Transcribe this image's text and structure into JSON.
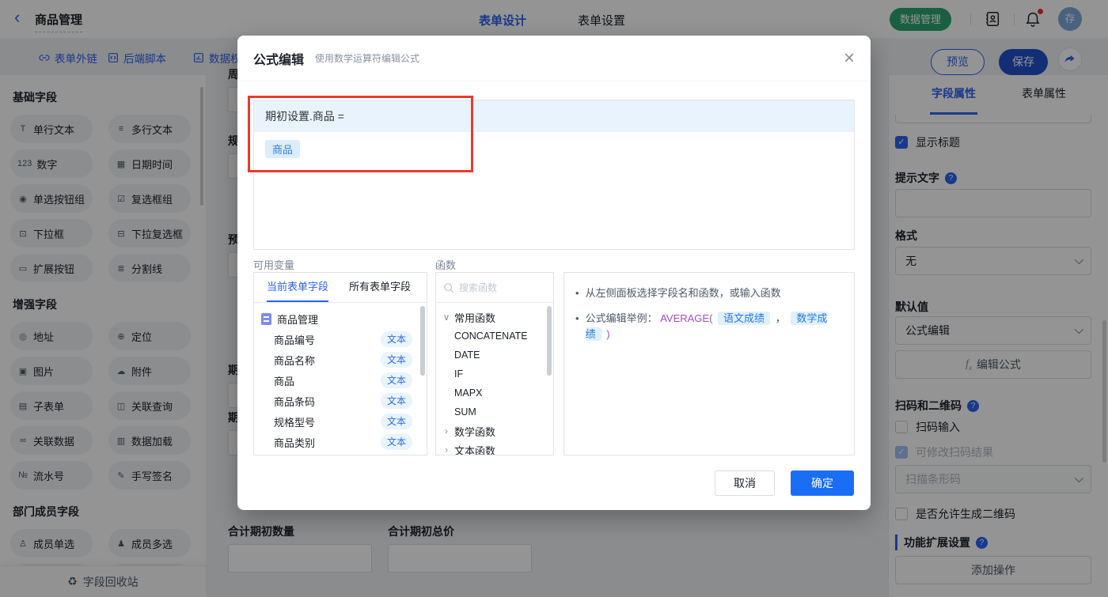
{
  "topbar": {
    "back_icon": "‹",
    "title": "商品管理",
    "tabs": [
      {
        "label": "表单设计"
      },
      {
        "label": "表单设置"
      }
    ],
    "data_manage_label": "数据管理",
    "avatar_text": "存"
  },
  "toolbar": {
    "links": [
      {
        "label": "表单外链"
      },
      {
        "label": "后端脚本"
      },
      {
        "label": "数据权"
      }
    ],
    "preview_label": "预览",
    "save_label": "保存"
  },
  "sidebar": {
    "basic": {
      "title": "基础字段",
      "items": [
        {
          "icon": "T",
          "label": "单行文本"
        },
        {
          "icon": "≡",
          "label": "多行文本"
        },
        {
          "icon": "123",
          "label": "数字"
        },
        {
          "icon": "▦",
          "label": "日期时间"
        },
        {
          "icon": "◉",
          "label": "单选按钮组"
        },
        {
          "icon": "☑",
          "label": "复选框组"
        },
        {
          "icon": "⊡",
          "label": "下拉框"
        },
        {
          "icon": "⊟",
          "label": "下拉复选框"
        },
        {
          "icon": "▭",
          "label": "扩展按钮"
        },
        {
          "icon": "≣",
          "label": "分割线"
        }
      ]
    },
    "enhanced": {
      "title": "增强字段",
      "items": [
        {
          "icon": "◎",
          "label": "地址"
        },
        {
          "icon": "⊕",
          "label": "定位"
        },
        {
          "icon": "▣",
          "label": "图片"
        },
        {
          "icon": "☁",
          "label": "附件"
        },
        {
          "icon": "▤",
          "label": "子表单"
        },
        {
          "icon": "◫",
          "label": "关联查询"
        },
        {
          "icon": "∞",
          "label": "关联数据"
        },
        {
          "icon": "▥",
          "label": "数据加载"
        },
        {
          "icon": "№",
          "label": "流水号"
        },
        {
          "icon": "✎",
          "label": "手写签名"
        }
      ]
    },
    "member": {
      "title": "部门成员字段",
      "items": [
        {
          "icon": "♙",
          "label": "成员单选"
        },
        {
          "icon": "♟",
          "label": "成员多选"
        }
      ]
    },
    "recycle_icon": "♻",
    "recycle_label": "字段回收站"
  },
  "canvas": {
    "partial_labels": [
      "周",
      "规",
      "预",
      "期",
      "期"
    ],
    "fields": [
      {
        "label": "合计期初数量",
        "value": ""
      },
      {
        "label": "合计期初总价",
        "value": ""
      }
    ]
  },
  "modal": {
    "title": "公式编辑",
    "subtitle": "使用数学运算符编辑公式",
    "close_icon": "×",
    "formula": {
      "lhs": "期初设置.商品 =",
      "tag": "商品"
    },
    "variables": {
      "label": "可用变量",
      "tabs": [
        {
          "label": "当前表单字段"
        },
        {
          "label": "所有表单字段"
        }
      ],
      "root": "商品管理",
      "fields": [
        {
          "name": "商品编号",
          "type": "文本"
        },
        {
          "name": "商品名称",
          "type": "文本"
        },
        {
          "name": "商品",
          "type": "文本"
        },
        {
          "name": "商品条码",
          "type": "文本"
        },
        {
          "name": "规格型号",
          "type": "文本"
        },
        {
          "name": "商品类别",
          "type": "文本"
        }
      ]
    },
    "functions": {
      "label": "函数",
      "search_placeholder": "搜索函数",
      "group_expanded": "常用函数",
      "items": [
        "CONCATENATE",
        "DATE",
        "IF",
        "MAPX",
        "SUM"
      ],
      "groups_collapsed": [
        "数学函数",
        "文本函数"
      ]
    },
    "tips": {
      "line1": "从左侧面板选择字段名和函数，或输入函数",
      "line2_prefix": "公式编辑举例：",
      "fn_open": "AVERAGE(",
      "arg1": "语文成绩",
      "comma": "，",
      "arg2": "数学成绩",
      "fn_close": ")"
    },
    "cancel_label": "取消",
    "ok_label": "确定"
  },
  "props": {
    "tabs": [
      {
        "label": "字段属性"
      },
      {
        "label": "表单属性"
      }
    ],
    "show_title_label": "显示标题",
    "hint_label": "提示文字",
    "format_label": "格式",
    "format_value": "无",
    "default_label": "默认值",
    "default_value": "公式编辑",
    "edit_formula_label": "编辑公式",
    "scan_title": "扫码和二维码",
    "scan_input_label": "扫码输入",
    "scan_modify_label": "可修改扫码结果",
    "scan_mode_value": "扫描条形码",
    "qr_label": "是否允许生成二维码",
    "ext_title": "功能扩展设置",
    "add_action_label": "添加操作"
  },
  "colors": {
    "primary": "#2b62f0",
    "green": "#2ba471",
    "annotation_red": "#e93a2e",
    "tag_blue": "#2878e8"
  }
}
